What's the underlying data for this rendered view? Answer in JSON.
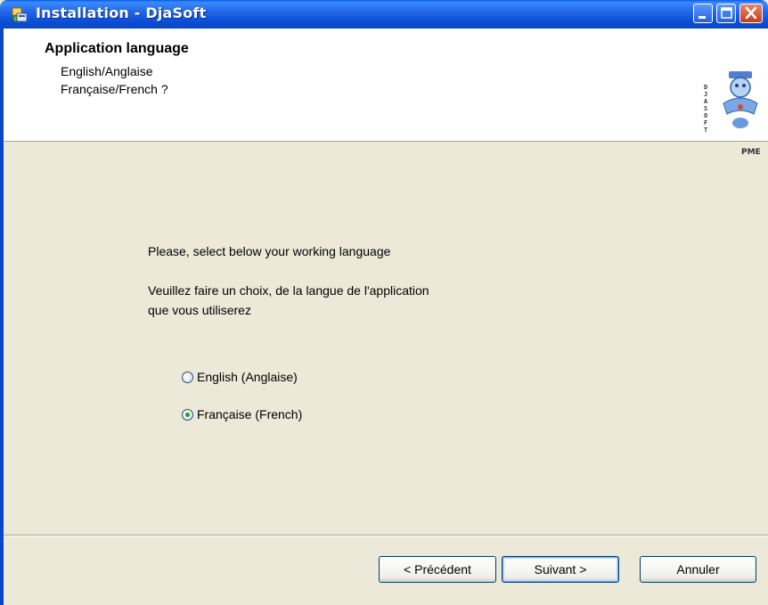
{
  "window": {
    "title": "Installation - DjaSoft"
  },
  "header": {
    "title": "Application language",
    "line1": "English/Anglaise",
    "line2": "Française/French ?",
    "logo": {
      "side_text": "DJASOFT",
      "caption": "PME"
    }
  },
  "content": {
    "prompt_en": "Please, select below your working language",
    "prompt_fr_line1": "Veuillez faire un choix, de la langue de l'application",
    "prompt_fr_line2": "que vous utiliserez",
    "options": [
      {
        "label": "English (Anglaise)",
        "selected": false
      },
      {
        "label": "Française (French)",
        "selected": true
      }
    ]
  },
  "buttons": {
    "prev": "< Précédent",
    "next": "Suivant >",
    "cancel": "Annuler"
  },
  "icons": [
    "installer-icon",
    "minimize-icon",
    "maximize-icon",
    "close-icon"
  ],
  "colors": {
    "titlebar": "#0a5ae8",
    "face": "#ece9d8",
    "radio_dot": "#21a121",
    "close": "#c53c18"
  }
}
